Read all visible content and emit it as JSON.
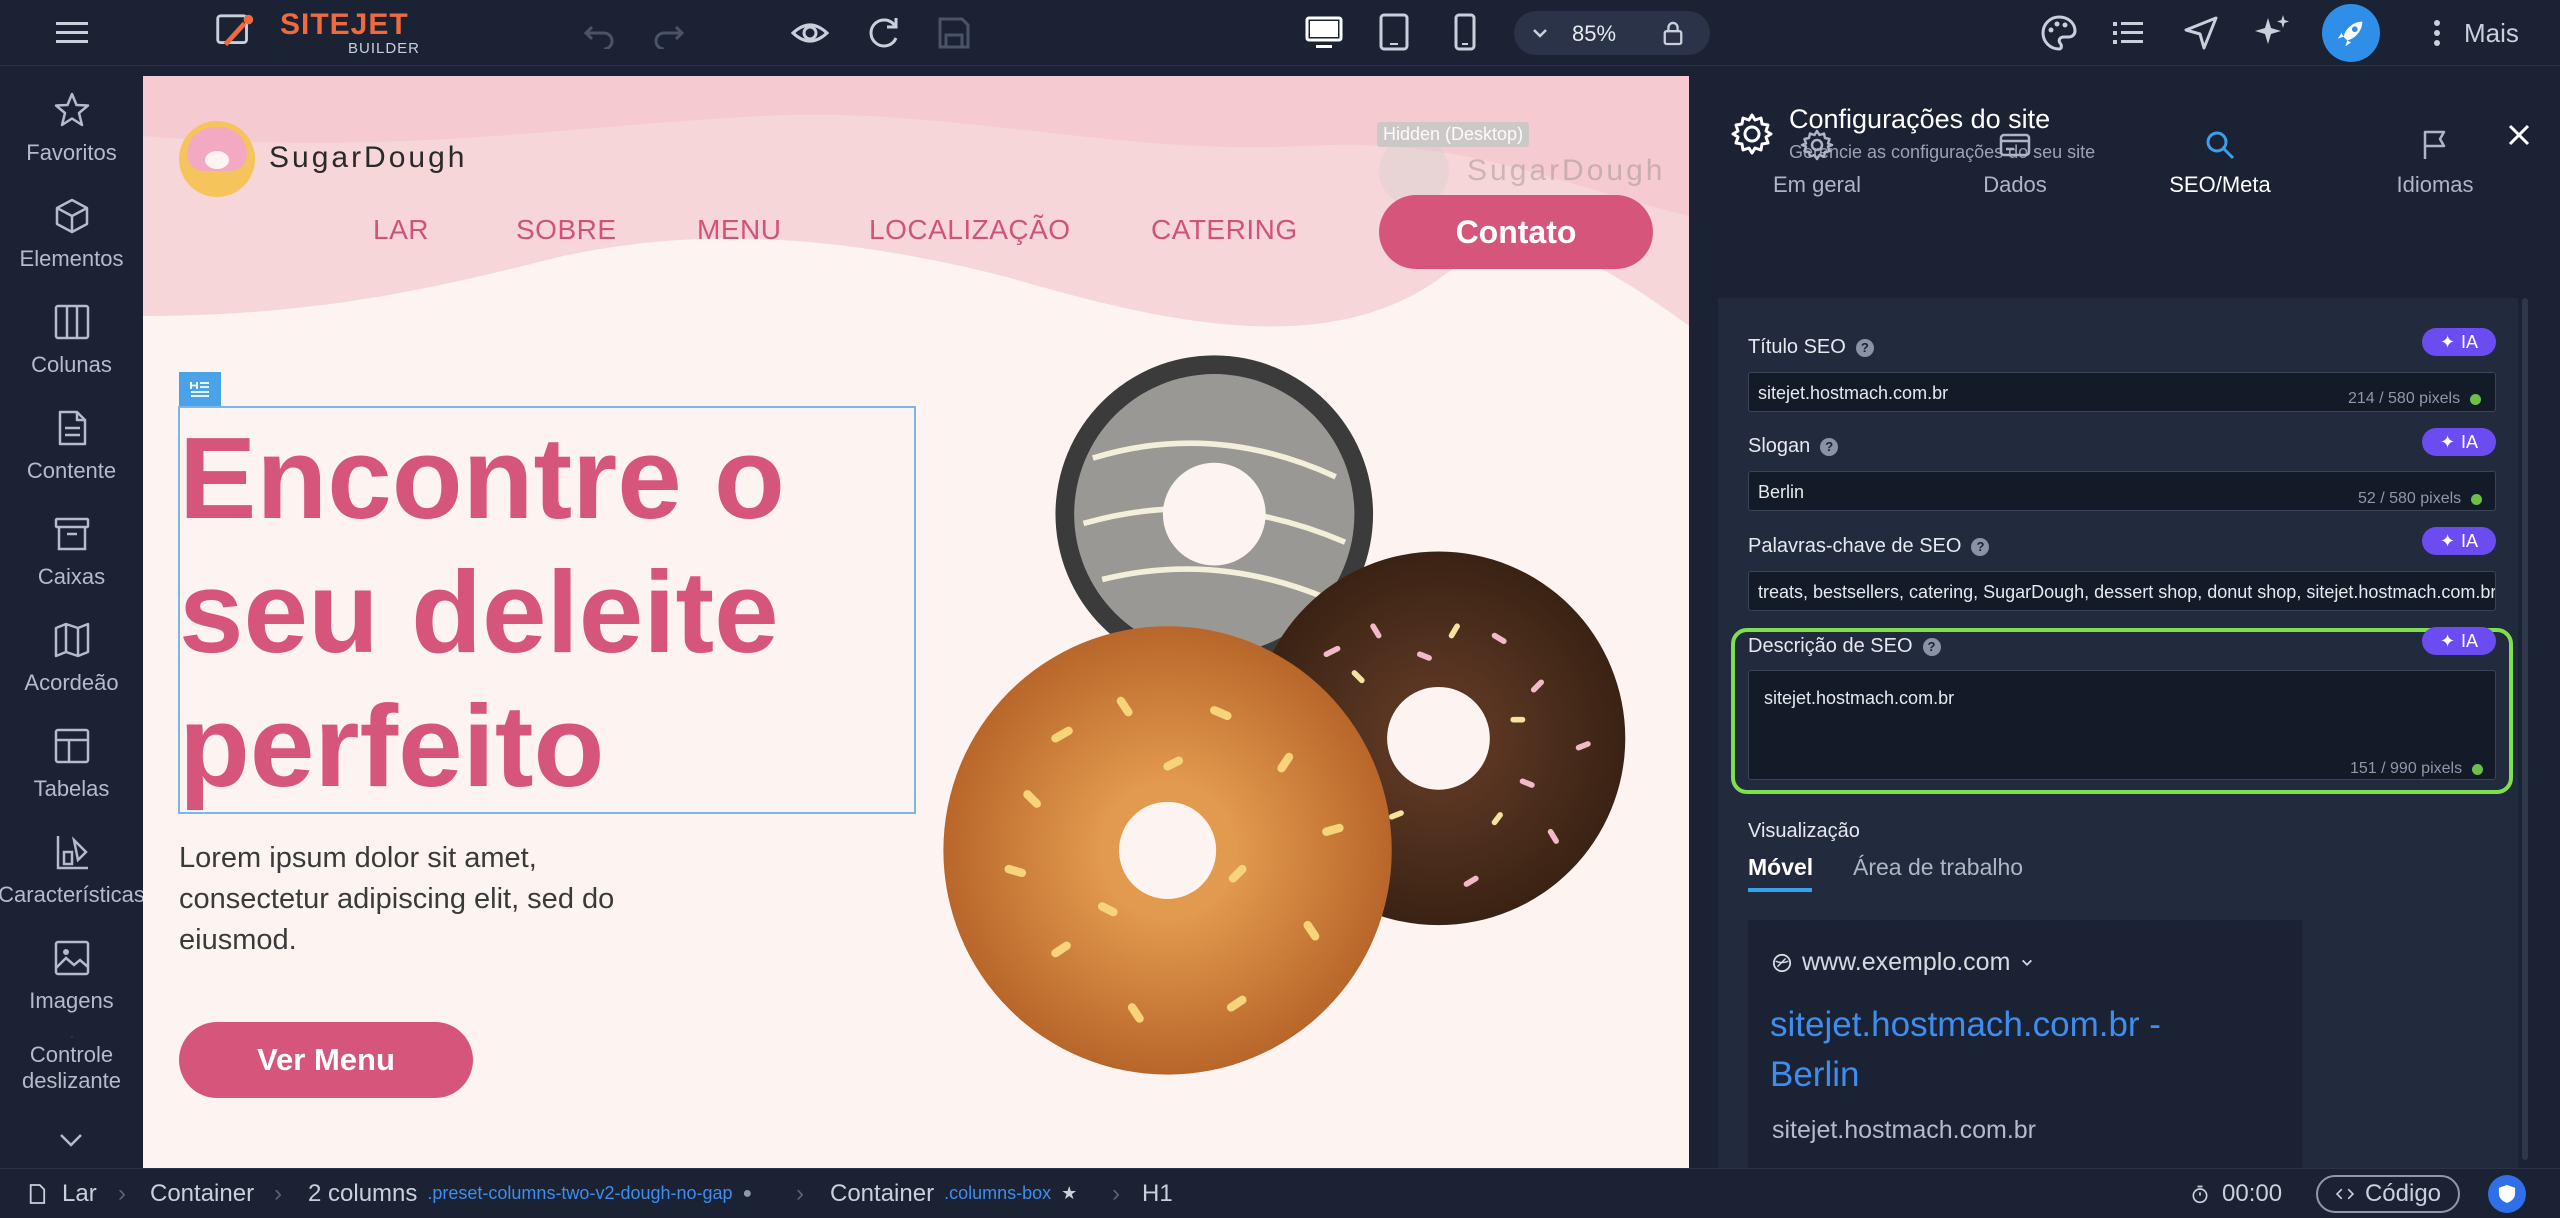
{
  "topbar": {
    "logo_name": "SITEJET",
    "logo_sub": "BUILDER",
    "zoom": "85%",
    "more_label": "Mais",
    "icons": [
      "menu-icon",
      "undo-icon",
      "redo-icon",
      "eye-icon",
      "refresh-icon",
      "save-icon",
      "desktop-icon",
      "tablet-icon",
      "mobile-icon",
      "chevron-down-icon",
      "lock-icon",
      "palette-icon",
      "list-icon",
      "navigation-icon",
      "sparkle-icon",
      "rocket-icon",
      "more-vertical-icon"
    ]
  },
  "sidebar": {
    "items": [
      {
        "label": "Favoritos",
        "icon": "star-icon"
      },
      {
        "label": "Elementos",
        "icon": "cube-icon"
      },
      {
        "label": "Colunas",
        "icon": "columns-icon"
      },
      {
        "label": "Contente",
        "icon": "document-icon"
      },
      {
        "label": "Caixas",
        "icon": "archive-icon"
      },
      {
        "label": "Acordeão",
        "icon": "map-icon"
      },
      {
        "label": "Tabelas",
        "icon": "table-icon"
      },
      {
        "label": "Características",
        "icon": "features-icon"
      },
      {
        "label": "Imagens",
        "icon": "image-icon"
      },
      {
        "label": "Controle deslizante",
        "icon": "arrows-icon"
      }
    ]
  },
  "site": {
    "brand": "SugarDough",
    "hidden_badge": "Hidden (Desktop)",
    "nav": [
      "LAR",
      "SOBRE",
      "MENU",
      "LOCALIZAÇÃO",
      "CATERING"
    ],
    "cta": "Contato",
    "hero_line1": "Encontre o",
    "hero_line2": "seu deleite",
    "hero_line3": "perfeito",
    "body_line1": "Lorem ipsum dolor sit amet,",
    "body_line2": "consectetur adipiscing elit, sed do",
    "body_line3": "eiusmod.",
    "button": "Ver Menu",
    "colors": {
      "pink": "#d6557b",
      "cream": "#fdf4f2"
    }
  },
  "panel": {
    "title": "Configurações do site",
    "subtitle": "Gerencie as configurações do seu site",
    "tabs": [
      {
        "label": "Em geral",
        "icon": "gear-icon"
      },
      {
        "label": "Dados",
        "icon": "card-icon"
      },
      {
        "label": "SEO/Meta",
        "icon": "search-icon"
      },
      {
        "label": "Idiomas",
        "icon": "flag-icon"
      }
    ],
    "active_tab": "SEO/Meta",
    "ia_label": "IA",
    "fields": {
      "seo_title": {
        "label": "Título SEO",
        "value": "sitejet.hostmach.com.br",
        "counter": "214 / 580 pixels"
      },
      "slogan": {
        "label": "Slogan",
        "value": "Berlin",
        "counter": "52 / 580 pixels"
      },
      "keywords": {
        "label": "Palavras-chave de SEO",
        "value": "treats, bestsellers, catering, SugarDough, dessert shop, donut shop, sitejet.hostmach.com.br,"
      },
      "description": {
        "label": "Descrição de SEO",
        "value": "sitejet.hostmach.com.br",
        "counter": "151 / 990 pixels"
      }
    },
    "preview": {
      "label": "Visualização",
      "tab_mobile": "Móvel",
      "tab_desktop": "Área de trabalho",
      "url": "www.exemplo.com",
      "title_line1": "sitejet.hostmach.com.br -",
      "title_line2": "Berlin",
      "desc": "sitejet.hostmach.com.br"
    }
  },
  "breadcrumb": {
    "items": [
      "Lar",
      "Container",
      "2 columns",
      "Container",
      "H1"
    ],
    "class_2col": ".preset-columns-two-v2-dough-no-gap",
    "class_container": ".columns-box",
    "time": "00:00",
    "code_label": "Código"
  }
}
